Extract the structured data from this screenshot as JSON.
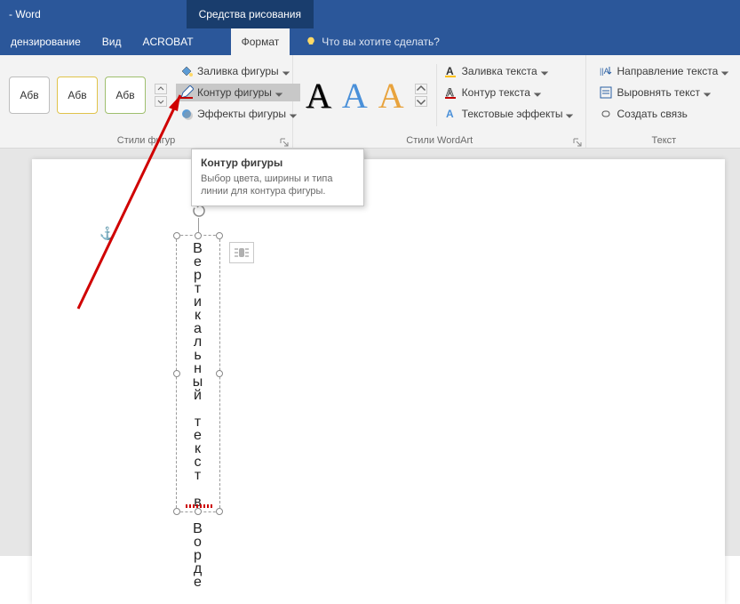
{
  "titlebar": {
    "app_title": "- Word",
    "context_tab": "Средства рисования"
  },
  "tabs": {
    "review": "дензирование",
    "view": "Вид",
    "acrobat": "ACROBAT",
    "format": "Формат",
    "tell_me": "Что вы хотите сделать?"
  },
  "ribbon": {
    "shape_styles": {
      "label": "Стили фигур",
      "thumb_text": "Абв",
      "fill": "Заливка фигуры",
      "outline": "Контур фигуры",
      "effects": "Эффекты фигуры"
    },
    "wordart": {
      "label": "Стили WordArt",
      "sample": "A",
      "text_fill": "Заливка текста",
      "text_outline": "Контур текста",
      "text_effects": "Текстовые эффекты"
    },
    "text": {
      "label": "Текст",
      "direction": "Направление текста",
      "align": "Выровнять текст",
      "link": "Создать связь"
    }
  },
  "tooltip": {
    "title": "Контур фигуры",
    "body": "Выбор цвета, ширины и типа линии для контура фигуры."
  },
  "document": {
    "textbox_content": "Вертикальный текст в Ворде"
  }
}
